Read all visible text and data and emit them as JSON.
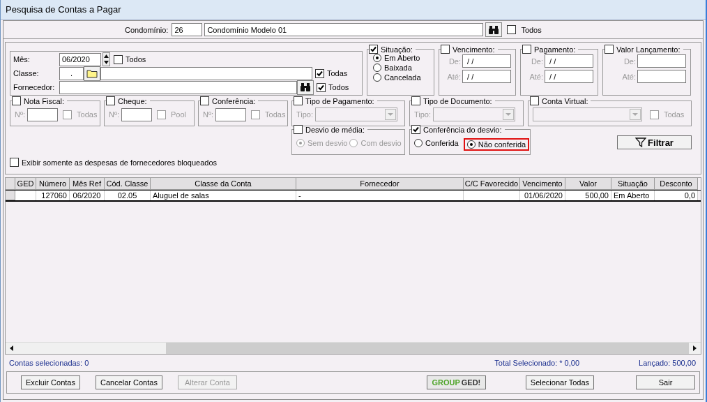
{
  "window": {
    "title": "Pesquisa de Contas a Pagar"
  },
  "condominio": {
    "label": "Condomínio:",
    "code": "26",
    "name": "Condomínio Modelo 01",
    "all": {
      "label": "Todos",
      "checked": false
    }
  },
  "filters": {
    "month": {
      "label": "Mês:",
      "value": "06/2020",
      "all": {
        "label": "Todos",
        "checked": false
      }
    },
    "classe": {
      "label": "Classe:",
      "code": ".",
      "all": {
        "label": "Todas",
        "checked": true
      }
    },
    "fornecedor": {
      "label": "Fornecedor:",
      "all": {
        "label": "Todos",
        "checked": true
      }
    },
    "situacao": {
      "label": "Situação:",
      "checked": true,
      "options": [
        {
          "label": "Em Aberto",
          "selected": true
        },
        {
          "label": "Baixada",
          "selected": false
        },
        {
          "label": "Cancelada",
          "selected": false
        }
      ]
    },
    "range_groups": [
      {
        "label": "Vencimento:",
        "checked": false,
        "from_label": "De:",
        "from": " / /",
        "to_label": "Até:",
        "to": " / /"
      },
      {
        "label": "Pagamento:",
        "checked": false,
        "from_label": "De:",
        "from": " / /",
        "to_label": "Até:",
        "to": " / /"
      },
      {
        "label": "Valor Lançamento:",
        "checked": false,
        "from_label": "De:",
        "to_label": "Até:"
      }
    ],
    "number_groups": [
      {
        "label": "Nota Fiscal:",
        "checked": false,
        "field_label": "Nº:",
        "option": {
          "label": "Todas",
          "checked": false
        }
      },
      {
        "label": "Cheque:",
        "checked": false,
        "field_label": "Nº:",
        "option": {
          "label": "Pool",
          "checked": false
        }
      },
      {
        "label": "Conferência:",
        "checked": false,
        "field_label": "Nº:",
        "option": {
          "label": "Todas",
          "checked": false
        }
      }
    ],
    "type_groups": [
      {
        "label": "Tipo de Pagamento:",
        "checked": false,
        "field_label": "Tipo:"
      },
      {
        "label": "Tipo de Documento:",
        "checked": false,
        "field_label": "Tipo:"
      }
    ],
    "conta_virtual": {
      "label": "Conta Virtual:",
      "checked": false,
      "option": {
        "label": "Todas",
        "checked": false
      }
    },
    "desvio_media": {
      "label": "Desvio de média:",
      "checked": false,
      "options": [
        {
          "label": "Sem desvio",
          "selected": true
        },
        {
          "label": "Com desvio",
          "selected": false
        }
      ]
    },
    "conferencia_desvio": {
      "label": "Conferência do desvio:",
      "checked": true,
      "options": [
        {
          "label": "Conferida",
          "selected": false,
          "highlighted": false
        },
        {
          "label": "Não conferida",
          "selected": true,
          "highlighted": true
        }
      ]
    },
    "filter_button": "Filtrar",
    "blocked_only": {
      "label": "Exibir somente as despesas de fornecedores bloqueados",
      "checked": false
    }
  },
  "table": {
    "columns": [
      "GED",
      "Número",
      "Mês Ref",
      "Cód. Classe",
      "Classe da Conta",
      "Fornecedor",
      "C/C Favorecido",
      "Vencimento",
      "Valor",
      "Situação",
      "Desconto"
    ],
    "rows": [
      {
        "selected": true,
        "cells": [
          "",
          "127060",
          "06/2020",
          "02.05",
          "Aluguel de salas",
          "-",
          "",
          "01/06/2020",
          "500,00",
          "Em Aberto",
          "0,0"
        ]
      }
    ]
  },
  "status": {
    "selected_count": "Contas selecionadas: 0",
    "total": "Total Selecionado: * 0,00",
    "posted": "Lançado: 500,00"
  },
  "buttons": [
    {
      "kind": "text",
      "label": "Excluir Contas",
      "disabled": false
    },
    {
      "kind": "text",
      "label": "Cancelar Contas",
      "disabled": false
    },
    {
      "kind": "text",
      "label": "Alterar Conta",
      "disabled": true
    },
    {
      "kind": "logo",
      "parts": [
        "GROUP",
        "GED!"
      ],
      "disabled": false
    },
    {
      "kind": "text",
      "label": "Selecionar Todas",
      "disabled": false
    },
    {
      "kind": "text",
      "label": "Sair",
      "disabled": false
    }
  ]
}
